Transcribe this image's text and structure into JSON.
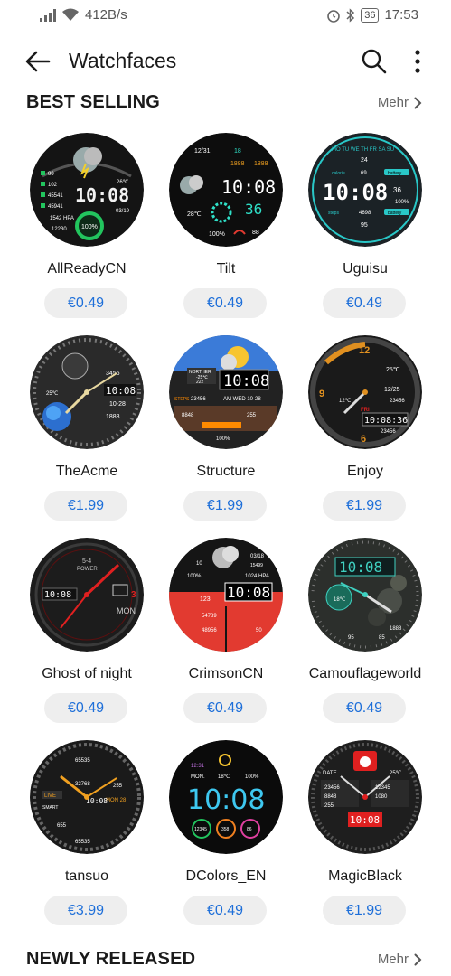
{
  "status": {
    "speed": "412B/s",
    "battery": "36",
    "time": "17:53"
  },
  "appbar": {
    "title": "Watchfaces"
  },
  "best": {
    "title": "BEST SELLING",
    "more": "Mehr"
  },
  "newly": {
    "title": "NEWLY RELEASED",
    "more": "Mehr"
  },
  "items": [
    {
      "name": "AllReadyCN",
      "price": "€0.49",
      "face": {
        "bg": "#141414",
        "accent": "#22c55e",
        "time": "10:08",
        "t1": "99",
        "t2": "102",
        "t3": "45541",
        "t4": "45941",
        "t5": "1542 HPA",
        "t6": "12230",
        "t7": "26℃",
        "t8": "03/19",
        "t9": "100%"
      }
    },
    {
      "name": "Tilt",
      "price": "€0.49",
      "face": {
        "bg": "#0d0d0d",
        "accent": "#2fe0c8",
        "time": "10:08",
        "t1": "12/31",
        "t2": "18",
        "t3": "1888",
        "t4": "1888",
        "t5": "28℃",
        "t6": "36",
        "t7": "100%",
        "t8": "88"
      }
    },
    {
      "name": "Uguisu",
      "price": "€0.49",
      "face": {
        "bg": "#1b2226",
        "accent": "#29c7c7",
        "time": "10:08",
        "t1": "MO TU WE TH FR SA SU",
        "t2": "24",
        "t3": "69",
        "t4": "calorie",
        "t5": "battery",
        "t6": "36",
        "t7": "100%",
        "t8": "4698",
        "t9": "steps",
        "t10": "95",
        "t11": "battery"
      }
    },
    {
      "name": "TheAcme",
      "price": "€1.99",
      "face": {
        "bg": "#2a2a2a",
        "accent": "#e8d8a0",
        "time": "10:08",
        "t1": "3456",
        "t2": "25℃",
        "t3": "10-28",
        "t4": "1888"
      }
    },
    {
      "name": "Structure",
      "price": "€1.99",
      "face": {
        "bg": "#222",
        "accent": "#ff8a00",
        "time": "10:08",
        "t1": "NORTHER",
        "t2": "-25℃",
        "t3": "222",
        "t4": "23456",
        "t5": "STEPS",
        "t6": "AM WED 10-28",
        "t7": "8848",
        "t8": "255",
        "t9": "100%"
      }
    },
    {
      "name": "Enjoy",
      "price": "€1.99",
      "face": {
        "bg": "#1a1a1a",
        "accent": "#e09020",
        "time": "10:08:36",
        "t1": "12",
        "t2": "25℃",
        "t3": "12/25",
        "t4": "23456",
        "t5": "23456",
        "t6": "12℃",
        "t7": "FRI",
        "t8": "6",
        "t9": "9"
      }
    },
    {
      "name": "Ghost of night",
      "price": "€0.49",
      "face": {
        "bg": "#1c1c1c",
        "accent": "#e02020",
        "time": "10:08",
        "t1": "5-4",
        "t2": "POWER",
        "t3": "MON",
        "t4": "3"
      }
    },
    {
      "name": "CrimsonCN",
      "price": "€0.49",
      "face": {
        "bg": "#151515",
        "accent": "#e23a30",
        "time": "10:08",
        "t1": "03/18",
        "t2": "15499",
        "t3": "100%",
        "t4": "1024 HPA",
        "t5": "123",
        "t6": "54789",
        "t7": "48956",
        "t8": "50",
        "t9": "10"
      }
    },
    {
      "name": "Camouflageworld",
      "price": "€0.49",
      "face": {
        "bg": "#2c2f2c",
        "accent": "#3fd0c0",
        "time": "10:08",
        "t1": "18℃",
        "t2": "1888",
        "t3": "95",
        "t4": "85"
      }
    },
    {
      "name": "tansuo",
      "price": "€3.99",
      "face": {
        "bg": "#1a1a1a",
        "accent": "#f0a020",
        "time": "10:08",
        "t1": "65535",
        "t2": "32768",
        "t3": "255",
        "t4": "655",
        "t5": "LIVE",
        "t6": "MON 28",
        "t7": "SMART",
        "t8": "65535"
      }
    },
    {
      "name": "DColors_EN",
      "price": "€0.49",
      "face": {
        "bg": "#0b0b0b",
        "accent": "#3ec8f0",
        "time": "10:08",
        "t1": "12:31",
        "t2": "MON.",
        "t3": "18℃",
        "t4": "100%",
        "t5": "12345",
        "t6": "358",
        "t7": "86"
      }
    },
    {
      "name": "MagicBlack",
      "price": "€1.99",
      "face": {
        "bg": "#1e1e1e",
        "accent": "#e02020",
        "time": "10:08",
        "t1": "DATE",
        "t2": "23456",
        "t3": "8848",
        "t4": "1080",
        "t5": "255",
        "t6": "25℃",
        "t7": "12345"
      }
    }
  ]
}
